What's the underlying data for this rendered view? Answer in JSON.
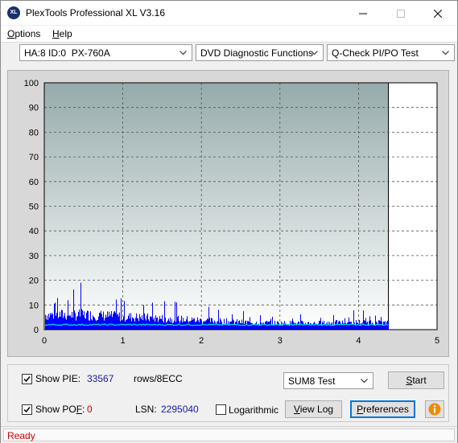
{
  "window": {
    "title": "PlexTools Professional XL V3.16",
    "icon_text": "XL",
    "controls": [
      "minimize-icon",
      "maximize-icon",
      "close-icon"
    ]
  },
  "menu": [
    {
      "label": "Options",
      "underline": "O"
    },
    {
      "label": "Help",
      "underline": "H"
    }
  ],
  "toolbar": {
    "drive": "HA:8 ID:0  PX-760A",
    "function": "DVD Diagnostic Functions",
    "test": "Q-Check PI/PO Test"
  },
  "chart_data": {
    "type": "bar",
    "xlim": [
      0,
      5
    ],
    "ylim": [
      0,
      100
    ],
    "x_ticks": [
      "0",
      "1",
      "2",
      "3",
      "4",
      "5"
    ],
    "y_ticks": [
      "0",
      "10",
      "20",
      "30",
      "40",
      "50",
      "60",
      "70",
      "80",
      "90",
      "100"
    ],
    "data_end_x": 4.38,
    "grid": true,
    "series": [
      {
        "color": "#0000ff",
        "profile_x": [
          0,
          0.5,
          1,
          1.5,
          2,
          2.5,
          3,
          3.5,
          4,
          4.38
        ],
        "profile_y": [
          8,
          8,
          7,
          6,
          5,
          4,
          3.5,
          3.5,
          4,
          3.5
        ],
        "peak_x": 0.46,
        "peak_y": 19
      },
      {
        "color": "#00e5e5",
        "profile_x": [
          0,
          1,
          2,
          3,
          4,
          4.38
        ],
        "profile_y": [
          2,
          2,
          2,
          2,
          2,
          2
        ]
      }
    ],
    "colors": {
      "bg_top": "#96abab",
      "bg_bottom": "#ffffff",
      "grid": "#555555"
    }
  },
  "panel": {
    "show_pie_label": "Show PIE:",
    "pie_value": "33567",
    "rows_label": "rows/8ECC",
    "show_pof_label": "Show POF:",
    "pof_value": "0",
    "lsn_label": "LSN:",
    "lsn_value": "2295040",
    "log_label": "Logarithmic",
    "sum_test": "SUM8 Test",
    "start": "Start",
    "view_log": "View Log",
    "preferences": "Preferences"
  },
  "status": "Ready"
}
